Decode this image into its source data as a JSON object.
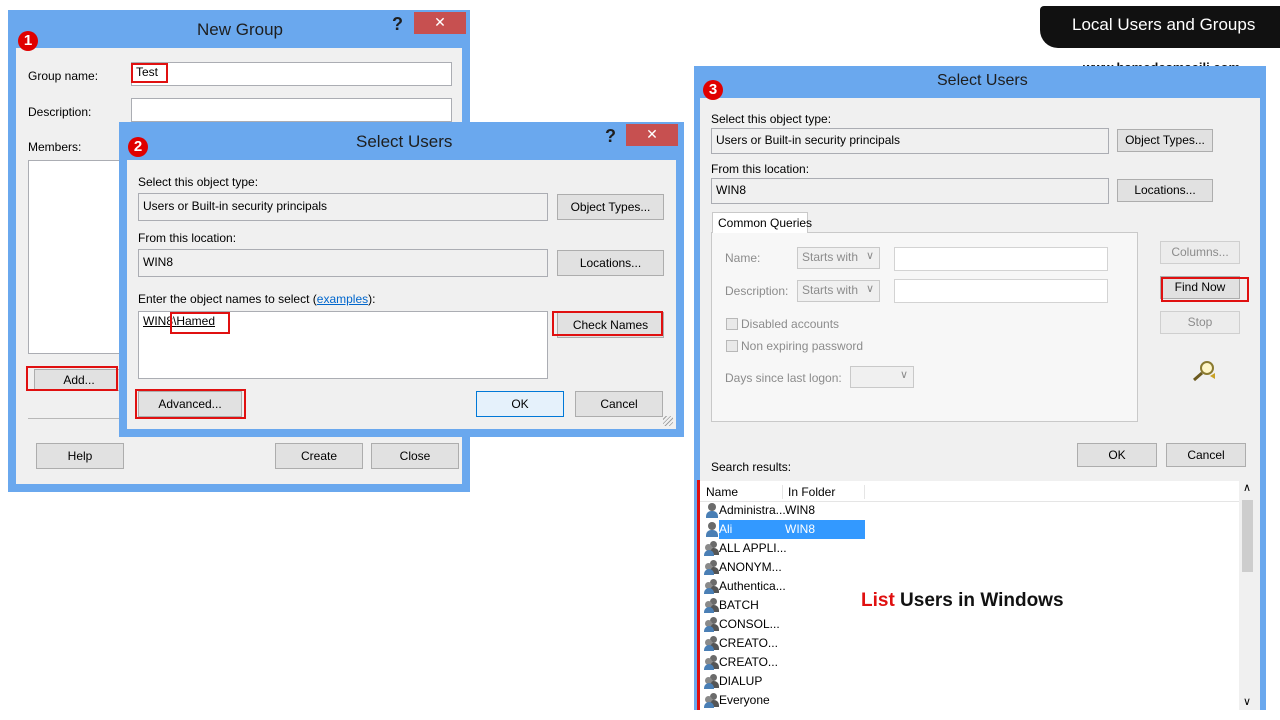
{
  "brand": {
    "banner_title": "Local Users and Groups",
    "website": "www.hamedesmaeili.com",
    "caption_highlight": "List",
    "caption_rest": " Users in Windows"
  },
  "markers": [
    "1",
    "2",
    "3"
  ],
  "new_group": {
    "title": "New Group",
    "help_glyph": "?",
    "close_glyph": "✕",
    "group_name_label": "Group name:",
    "group_name_value": "Test",
    "description_label": "Description:",
    "description_value": "",
    "members_label": "Members:",
    "add_button": "Add...",
    "help_button": "Help",
    "create_button": "Create",
    "close_button": "Close"
  },
  "select_users_small": {
    "title": "Select Users",
    "help_glyph": "?",
    "close_glyph": "✕",
    "object_type_label": "Select this object type:",
    "object_type_value": "Users or Built-in security principals",
    "object_types_button": "Object Types...",
    "location_label": "From this location:",
    "location_value": "WIN8",
    "locations_button": "Locations...",
    "enter_names_prefix": "Enter the object names to select (",
    "examples_link": "examples",
    "enter_names_suffix": "):",
    "names_value_domain": "WIN8",
    "names_value_user": "Hamed",
    "check_names_button": "Check Names",
    "advanced_button": "Advanced...",
    "ok_button": "OK",
    "cancel_button": "Cancel"
  },
  "select_users_large": {
    "title": "Select Users",
    "object_type_label": "Select this object type:",
    "object_type_value": "Users or Built-in security principals",
    "object_types_button": "Object Types...",
    "location_label": "From this location:",
    "location_value": "WIN8",
    "locations_button": "Locations...",
    "tab_common_queries": "Common Queries",
    "name_label": "Name:",
    "name_combo": "Starts with",
    "description_label": "Description:",
    "description_combo": "Starts with",
    "disabled_accounts": "Disabled accounts",
    "non_expiring": "Non expiring password",
    "days_since_logon": "Days since last logon:",
    "columns_button": "Columns...",
    "find_now_button": "Find Now",
    "stop_button": "Stop",
    "ok_button": "OK",
    "cancel_button": "Cancel",
    "search_results_label": "Search results:",
    "col_name": "Name",
    "col_folder": "In Folder",
    "results": [
      {
        "name": "Administra...",
        "folder": "WIN8",
        "icon": "user-icon"
      },
      {
        "name": "Ali",
        "folder": "WIN8",
        "icon": "user-icon",
        "selected": true
      },
      {
        "name": "ALL APPLI...",
        "folder": "",
        "icon": "group-icon"
      },
      {
        "name": "ANONYM...",
        "folder": "",
        "icon": "group-icon"
      },
      {
        "name": "Authentica...",
        "folder": "",
        "icon": "group-icon"
      },
      {
        "name": "BATCH",
        "folder": "",
        "icon": "group-icon"
      },
      {
        "name": "CONSOL...",
        "folder": "",
        "icon": "group-icon"
      },
      {
        "name": "CREATO...",
        "folder": "",
        "icon": "group-icon"
      },
      {
        "name": "CREATO...",
        "folder": "",
        "icon": "group-icon"
      },
      {
        "name": "DIALUP",
        "folder": "",
        "icon": "group-icon"
      },
      {
        "name": "Everyone",
        "folder": "",
        "icon": "group-icon"
      }
    ]
  },
  "colors": {
    "window_frame": "#6aa8ee",
    "close_red": "#c75050",
    "highlight_red": "#e01010",
    "selection_blue": "#3399ff"
  }
}
